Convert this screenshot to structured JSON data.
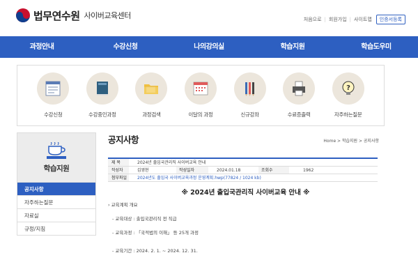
{
  "header": {
    "logo_main": "법무연수원",
    "logo_sub": "사이버교육센터",
    "util_links": [
      "처음으로",
      "회원가입",
      "사이트맵"
    ],
    "cert_button": "인증서등록"
  },
  "gnb": [
    "과정안내",
    "수강신청",
    "나의강의실",
    "학습지원",
    "학습도우미"
  ],
  "quick_menu": [
    {
      "label": "수강신청",
      "icon": "registration-form-icon"
    },
    {
      "label": "수강중인과정",
      "icon": "book-icon"
    },
    {
      "label": "과정검색",
      "icon": "folder-icon"
    },
    {
      "label": "이달의 과정",
      "icon": "calendar-icon"
    },
    {
      "label": "신규강좌",
      "icon": "pencils-icon"
    },
    {
      "label": "수료증출력",
      "icon": "printer-icon"
    },
    {
      "label": "자주하는질문",
      "icon": "question-bulb-icon"
    }
  ],
  "side": {
    "title": "학습지원",
    "items": [
      "공지사항",
      "자주하는질문",
      "자료실",
      "규정/지침"
    ]
  },
  "content": {
    "title": "공지사항",
    "breadcrumb": "Home > 학습지원 > 공지사항",
    "subject_label": "제 목",
    "subject": "2024년 출입국관리직 사이버교육 안내",
    "author_label": "작성자",
    "author": "김영현",
    "date_label": "작성일자",
    "date": "2024.01.18",
    "views_label": "조회수",
    "views": "1962",
    "attach_label": "첨부파일",
    "attachment": "2024년도 출입국 사이버교육과정 운영계획.hwp(77824 / 1024 kb)",
    "heading": "※ 2024년 출입국관리직 사이버교육 안내 ※",
    "body": [
      "› 교육계획 개요",
      "- 교육대상 : 출입국관리직 전 직급",
      "- 교육과정 : 「국적법의 이해」 등 25개 과정",
      "- 교육기간 : 2024. 2. 1. ~ 2024. 12. 31."
    ]
  },
  "colors": {
    "primary": "#2d5fc1",
    "icon_bg": "#ece6dc"
  }
}
